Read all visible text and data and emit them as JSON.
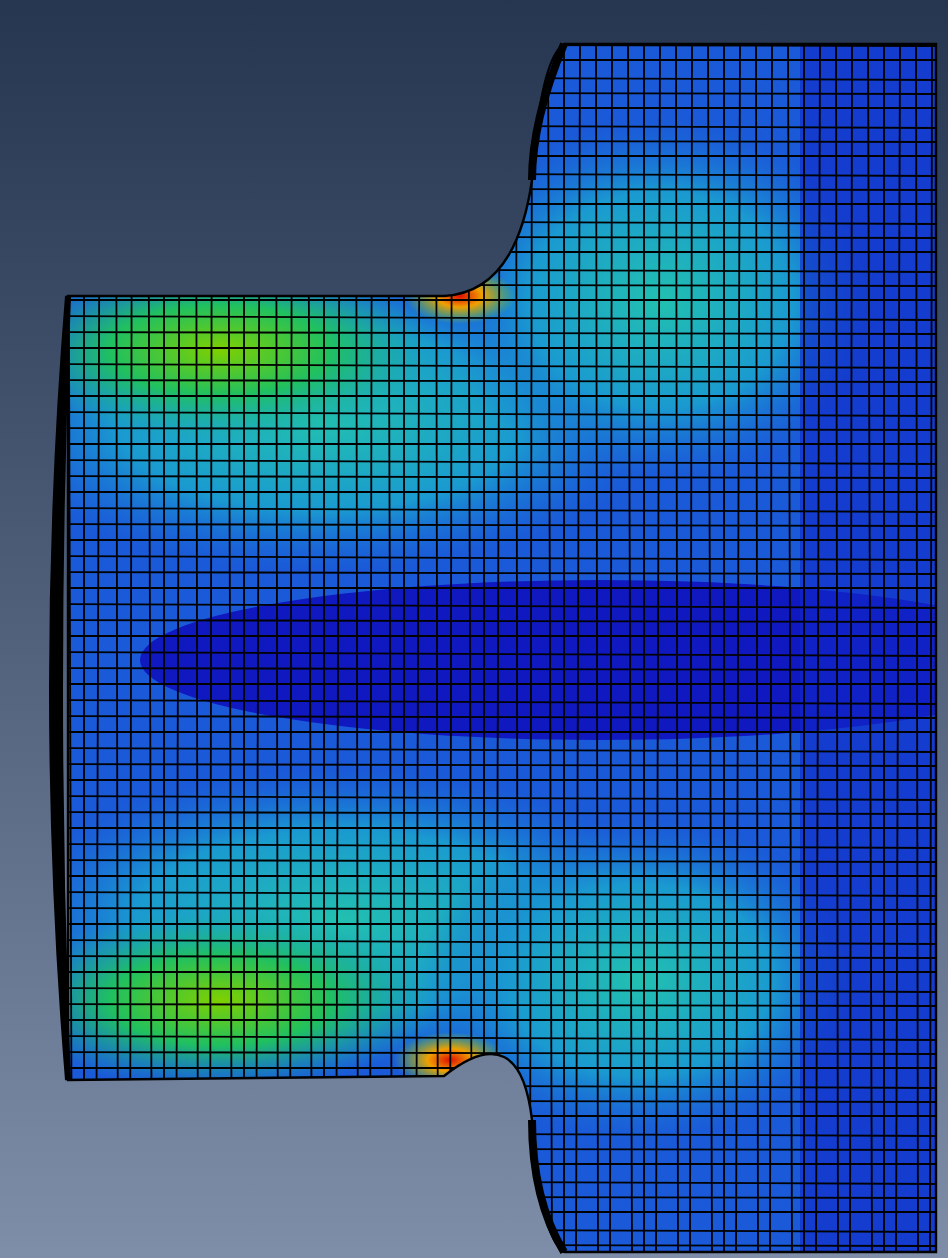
{
  "viewport": {
    "kind": "contour-plot"
  }
}
